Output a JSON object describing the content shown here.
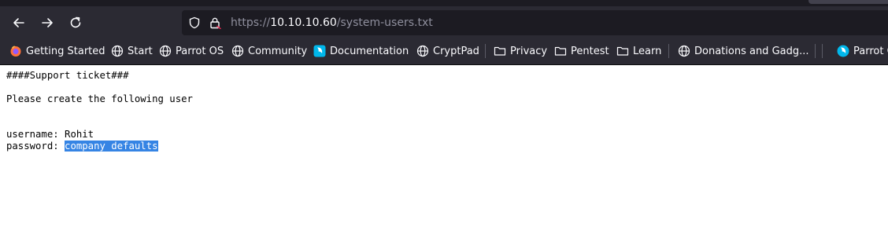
{
  "browser": {
    "url": {
      "scheme": "https://",
      "host": "10.10.10.60",
      "path": "/system-users.txt"
    },
    "nav_icons": [
      "back-arrow-icon",
      "forward-arrow-icon",
      "reload-icon"
    ],
    "url_icons": [
      "shield-icon",
      "lock-icon"
    ]
  },
  "bookmarks": [
    {
      "label": "Getting Started",
      "icon": "firefox-icon"
    },
    {
      "label": "Start",
      "icon": "globe-icon"
    },
    {
      "label": "Parrot OS",
      "icon": "globe-icon"
    },
    {
      "label": "Community",
      "icon": "globe-icon"
    },
    {
      "label": "Documentation",
      "icon": "parrot-icon"
    },
    {
      "label": "CryptPad",
      "icon": "globe-icon"
    },
    {
      "label": "Privacy",
      "icon": "folder-icon"
    },
    {
      "label": "Pentest",
      "icon": "folder-icon"
    },
    {
      "label": "Learn",
      "icon": "folder-icon"
    },
    {
      "label": "Donations and Gadg...",
      "icon": "globe-icon"
    },
    {
      "label": "Parrot O",
      "icon": "parrot-icon"
    }
  ],
  "document": {
    "heading": "####Support ticket###",
    "request": "Please create the following user",
    "username_label": "username: ",
    "username_value": "Rohit",
    "password_label": "password: ",
    "password_value": "company defaults"
  },
  "colors": {
    "chrome_bg": "#2b2a33",
    "urlbar_bg": "#1c1b22",
    "selection": "#3584e4",
    "parrot_accent": "#00b7eb",
    "firefox_orange": "#ff7139"
  }
}
